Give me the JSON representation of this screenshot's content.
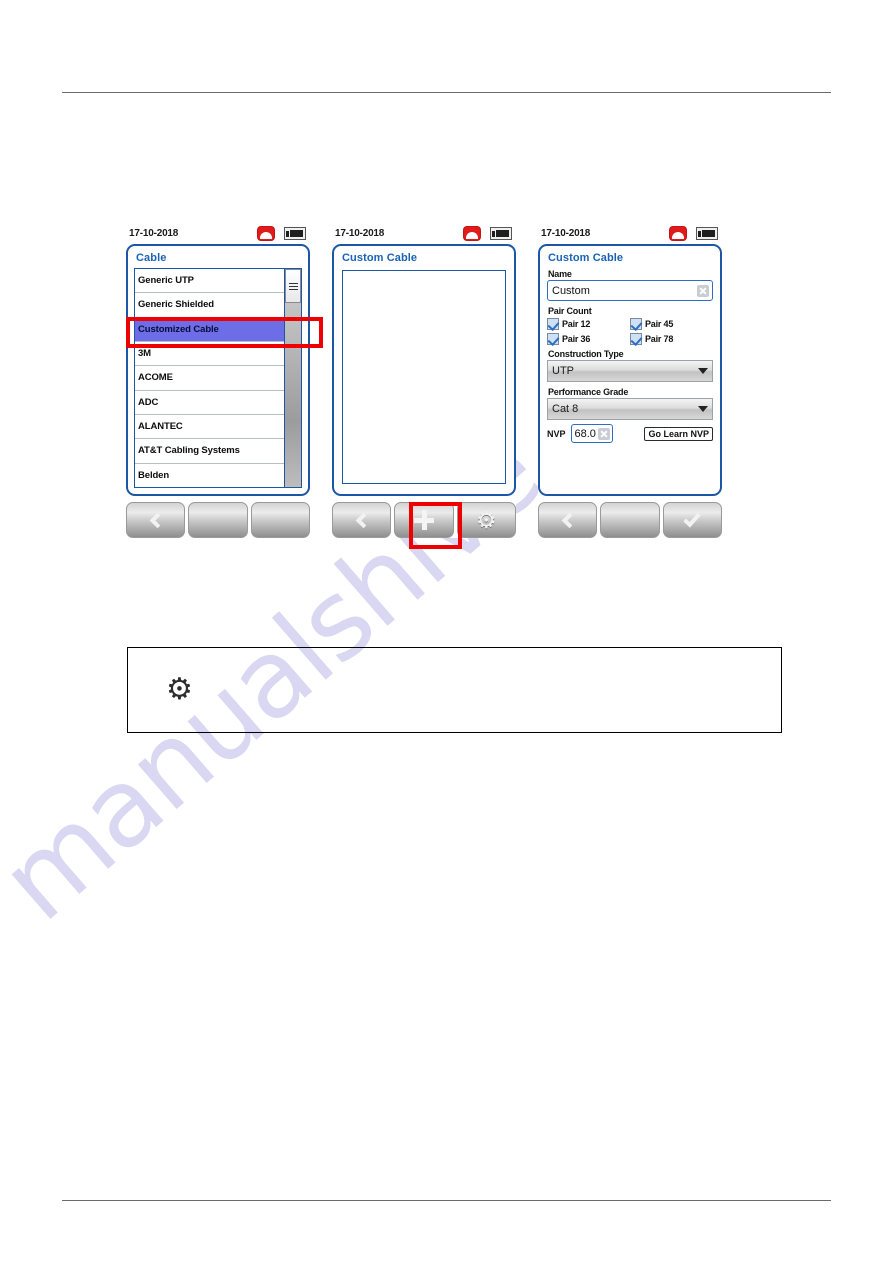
{
  "watermark": {
    "text": "manualshive"
  },
  "devices": [
    {
      "id": "cable-list",
      "statusbar": {
        "date": "17-10-2018",
        "phone_icon": "phone-down-icon",
        "battery_icon": "battery-icon"
      },
      "screen_title": "Cable",
      "list": [
        {
          "label": "Generic UTP",
          "selected": false
        },
        {
          "label": "Generic Shielded",
          "selected": false
        },
        {
          "label": "Customized Cable",
          "selected": true
        },
        {
          "label": "3M",
          "selected": false
        },
        {
          "label": "ACOME",
          "selected": false
        },
        {
          "label": "ADC",
          "selected": false
        },
        {
          "label": "ALANTEC",
          "selected": false
        },
        {
          "label": "AT&T Cabling Systems",
          "selected": false
        },
        {
          "label": "Belden",
          "selected": false
        }
      ],
      "buttons": [
        {
          "icon": "back-chevron-icon"
        },
        {
          "icon": "blank-icon"
        },
        {
          "icon": "blank-icon"
        }
      ]
    },
    {
      "id": "custom-cable-empty",
      "statusbar": {
        "date": "17-10-2018",
        "phone_icon": "phone-down-icon",
        "battery_icon": "battery-icon"
      },
      "screen_title": "Custom Cable",
      "buttons": [
        {
          "icon": "back-chevron-icon"
        },
        {
          "icon": "plus-icon"
        },
        {
          "icon": "gear-icon"
        }
      ]
    },
    {
      "id": "custom-cable-form",
      "statusbar": {
        "date": "17-10-2018",
        "phone_icon": "phone-down-icon",
        "battery_icon": "battery-icon"
      },
      "screen_title": "Custom Cable",
      "form": {
        "name_label": "Name",
        "name_value": "Custom",
        "pair_count_label": "Pair Count",
        "pairs": [
          {
            "label": "Pair 12",
            "checked": true
          },
          {
            "label": "Pair 45",
            "checked": true
          },
          {
            "label": "Pair 36",
            "checked": true
          },
          {
            "label": "Pair 78",
            "checked": true
          }
        ],
        "construction_label": "Construction Type",
        "construction_value": "UTP",
        "performance_label": "Performance Grade",
        "performance_value": "Cat 8",
        "nvp_label": "NVP",
        "nvp_value": "68.0",
        "learn_nvp_label": "Go Learn NVP"
      },
      "buttons": [
        {
          "icon": "back-chevron-icon"
        },
        {
          "icon": "blank-icon"
        },
        {
          "icon": "check-icon"
        }
      ]
    }
  ],
  "note_box": {
    "icon": "gear-icon",
    "text": ""
  },
  "colors": {
    "screen_border": "#1c57a5",
    "title_blue": "#1a62b5",
    "selection_purple": "#6d6de8",
    "highlight_red": "#ee0000",
    "status_red": "#e01b1b"
  }
}
